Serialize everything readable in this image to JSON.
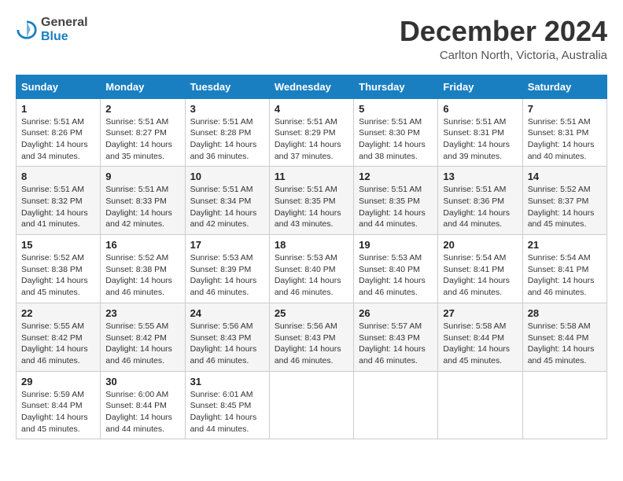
{
  "logo": {
    "general": "General",
    "blue": "Blue"
  },
  "header": {
    "month": "December 2024",
    "location": "Carlton North, Victoria, Australia"
  },
  "weekdays": [
    "Sunday",
    "Monday",
    "Tuesday",
    "Wednesday",
    "Thursday",
    "Friday",
    "Saturday"
  ],
  "weeks": [
    [
      {
        "day": "1",
        "sunrise": "5:51 AM",
        "sunset": "8:26 PM",
        "daylight": "14 hours and 34 minutes."
      },
      {
        "day": "2",
        "sunrise": "5:51 AM",
        "sunset": "8:27 PM",
        "daylight": "14 hours and 35 minutes."
      },
      {
        "day": "3",
        "sunrise": "5:51 AM",
        "sunset": "8:28 PM",
        "daylight": "14 hours and 36 minutes."
      },
      {
        "day": "4",
        "sunrise": "5:51 AM",
        "sunset": "8:29 PM",
        "daylight": "14 hours and 37 minutes."
      },
      {
        "day": "5",
        "sunrise": "5:51 AM",
        "sunset": "8:30 PM",
        "daylight": "14 hours and 38 minutes."
      },
      {
        "day": "6",
        "sunrise": "5:51 AM",
        "sunset": "8:31 PM",
        "daylight": "14 hours and 39 minutes."
      },
      {
        "day": "7",
        "sunrise": "5:51 AM",
        "sunset": "8:31 PM",
        "daylight": "14 hours and 40 minutes."
      }
    ],
    [
      {
        "day": "8",
        "sunrise": "5:51 AM",
        "sunset": "8:32 PM",
        "daylight": "14 hours and 41 minutes."
      },
      {
        "day": "9",
        "sunrise": "5:51 AM",
        "sunset": "8:33 PM",
        "daylight": "14 hours and 42 minutes."
      },
      {
        "day": "10",
        "sunrise": "5:51 AM",
        "sunset": "8:34 PM",
        "daylight": "14 hours and 42 minutes."
      },
      {
        "day": "11",
        "sunrise": "5:51 AM",
        "sunset": "8:35 PM",
        "daylight": "14 hours and 43 minutes."
      },
      {
        "day": "12",
        "sunrise": "5:51 AM",
        "sunset": "8:35 PM",
        "daylight": "14 hours and 44 minutes."
      },
      {
        "day": "13",
        "sunrise": "5:51 AM",
        "sunset": "8:36 PM",
        "daylight": "14 hours and 44 minutes."
      },
      {
        "day": "14",
        "sunrise": "5:52 AM",
        "sunset": "8:37 PM",
        "daylight": "14 hours and 45 minutes."
      }
    ],
    [
      {
        "day": "15",
        "sunrise": "5:52 AM",
        "sunset": "8:38 PM",
        "daylight": "14 hours and 45 minutes."
      },
      {
        "day": "16",
        "sunrise": "5:52 AM",
        "sunset": "8:38 PM",
        "daylight": "14 hours and 46 minutes."
      },
      {
        "day": "17",
        "sunrise": "5:53 AM",
        "sunset": "8:39 PM",
        "daylight": "14 hours and 46 minutes."
      },
      {
        "day": "18",
        "sunrise": "5:53 AM",
        "sunset": "8:40 PM",
        "daylight": "14 hours and 46 minutes."
      },
      {
        "day": "19",
        "sunrise": "5:53 AM",
        "sunset": "8:40 PM",
        "daylight": "14 hours and 46 minutes."
      },
      {
        "day": "20",
        "sunrise": "5:54 AM",
        "sunset": "8:41 PM",
        "daylight": "14 hours and 46 minutes."
      },
      {
        "day": "21",
        "sunrise": "5:54 AM",
        "sunset": "8:41 PM",
        "daylight": "14 hours and 46 minutes."
      }
    ],
    [
      {
        "day": "22",
        "sunrise": "5:55 AM",
        "sunset": "8:42 PM",
        "daylight": "14 hours and 46 minutes."
      },
      {
        "day": "23",
        "sunrise": "5:55 AM",
        "sunset": "8:42 PM",
        "daylight": "14 hours and 46 minutes."
      },
      {
        "day": "24",
        "sunrise": "5:56 AM",
        "sunset": "8:43 PM",
        "daylight": "14 hours and 46 minutes."
      },
      {
        "day": "25",
        "sunrise": "5:56 AM",
        "sunset": "8:43 PM",
        "daylight": "14 hours and 46 minutes."
      },
      {
        "day": "26",
        "sunrise": "5:57 AM",
        "sunset": "8:43 PM",
        "daylight": "14 hours and 46 minutes."
      },
      {
        "day": "27",
        "sunrise": "5:58 AM",
        "sunset": "8:44 PM",
        "daylight": "14 hours and 45 minutes."
      },
      {
        "day": "28",
        "sunrise": "5:58 AM",
        "sunset": "8:44 PM",
        "daylight": "14 hours and 45 minutes."
      }
    ],
    [
      {
        "day": "29",
        "sunrise": "5:59 AM",
        "sunset": "8:44 PM",
        "daylight": "14 hours and 45 minutes."
      },
      {
        "day": "30",
        "sunrise": "6:00 AM",
        "sunset": "8:44 PM",
        "daylight": "14 hours and 44 minutes."
      },
      {
        "day": "31",
        "sunrise": "6:01 AM",
        "sunset": "8:45 PM",
        "daylight": "14 hours and 44 minutes."
      },
      null,
      null,
      null,
      null
    ]
  ]
}
